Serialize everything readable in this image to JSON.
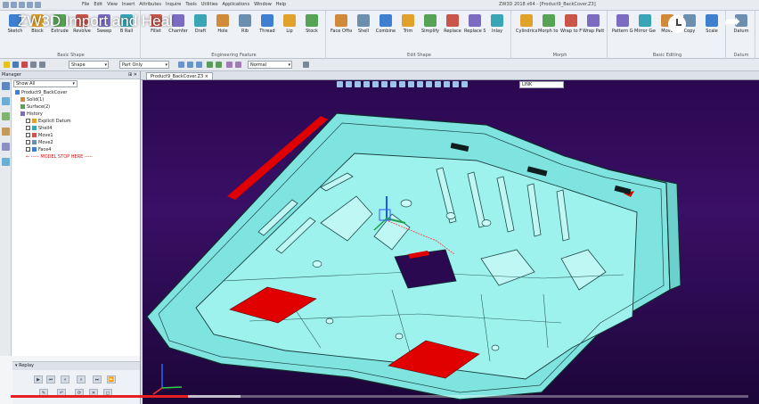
{
  "video": {
    "title": "ZW3D Import and Heal",
    "progress": 0.24
  },
  "app": {
    "window_title": "ZW3D 2018 x64 - [Product9_BackCover.Z3]",
    "menus": [
      "File",
      "Edit",
      "View",
      "Insert",
      "Attributes",
      "Inquire",
      "Tools",
      "Utilities",
      "Applications",
      "Window",
      "Help"
    ]
  },
  "ribbon": {
    "groups": [
      {
        "name": "Basic Shape",
        "buttons": [
          "Sketch",
          "Block",
          "Extrude",
          "Revolve",
          "Sweep",
          "B Rail"
        ]
      },
      {
        "name": "Engineering Feature",
        "buttons": [
          "Fillet",
          "Chamfer",
          "Draft",
          "Hole",
          "Rib",
          "Thread",
          "Lip",
          "Stock"
        ]
      },
      {
        "name": "Edit Shape",
        "buttons": [
          "Face Offset",
          "Shell",
          "Combine",
          "Trim",
          "Simplify",
          "Replace",
          "Replace Self",
          "Inlay"
        ]
      },
      {
        "name": "Morph",
        "buttons": [
          "Cylindrical Bend",
          "Morph to Curve",
          "Wrap to Face",
          "Wrap Pattern to Faces"
        ]
      },
      {
        "name": "Basic Editing",
        "buttons": [
          "Pattern Geometry",
          "Mirror Geometry",
          "Move",
          "Copy",
          "Scale"
        ]
      },
      {
        "name": "Datum",
        "buttons": [
          "Datum"
        ]
      }
    ]
  },
  "toolbar": {
    "shape_combo": "Shape",
    "part_combo": "Part Only",
    "view_combo": "Normal"
  },
  "manager": {
    "title": "Manager",
    "filter": "Show All",
    "tree": [
      {
        "label": "Product9_BackCover",
        "level": 0
      },
      {
        "label": "Solid(1)",
        "level": 1
      },
      {
        "label": "Surface(2)",
        "level": 1
      },
      {
        "label": "History",
        "level": 1
      },
      {
        "label": "Explicit Datum",
        "level": 2
      },
      {
        "label": "Shell4",
        "level": 2
      },
      {
        "label": "Move1",
        "level": 2
      },
      {
        "label": "Move2",
        "level": 2
      },
      {
        "label": "Face4",
        "level": 2
      }
    ],
    "stop_label": "----- MODEL STOP HERE -----",
    "replay_title": "Replay"
  },
  "document": {
    "tab_label": "Product9_BackCover.Z3",
    "filter_value": "LINK"
  },
  "colors": {
    "part": "#7fe3e0",
    "part_edge": "#0f2b2b",
    "highlight": "#e00000",
    "viewport_bg": "#2f0a5a",
    "progress": "#e52020"
  }
}
